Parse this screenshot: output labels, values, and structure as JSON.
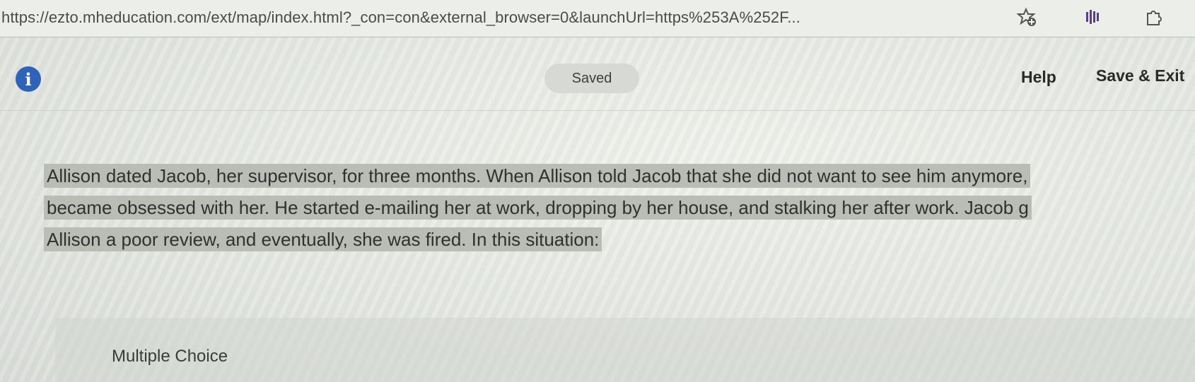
{
  "browser": {
    "url": "https://ezto.mheducation.com/ext/map/index.html?_con=con&external_browser=0&launchUrl=https%253A%252F...",
    "icons": {
      "favorite": "star-plus-icon",
      "extension": "extension-bars-icon",
      "puzzle": "puzzle-piece-icon"
    }
  },
  "header": {
    "info_icon": "i",
    "status": "Saved",
    "help_label": "Help",
    "save_exit_label": "Save & Exit"
  },
  "question": {
    "lines": [
      "Allison dated Jacob, her supervisor, for three months. When Allison told Jacob that she did not want to see him anymore,",
      "became obsessed with her. He started e-mailing her at work, dropping by her house, and stalking her after work. Jacob g",
      "Allison a poor review, and eventually, she was fired. In this situation:"
    ],
    "type_label": "Multiple Choice"
  },
  "colors": {
    "info_blue": "#2f63b8",
    "highlight": "#b9bdb6"
  }
}
